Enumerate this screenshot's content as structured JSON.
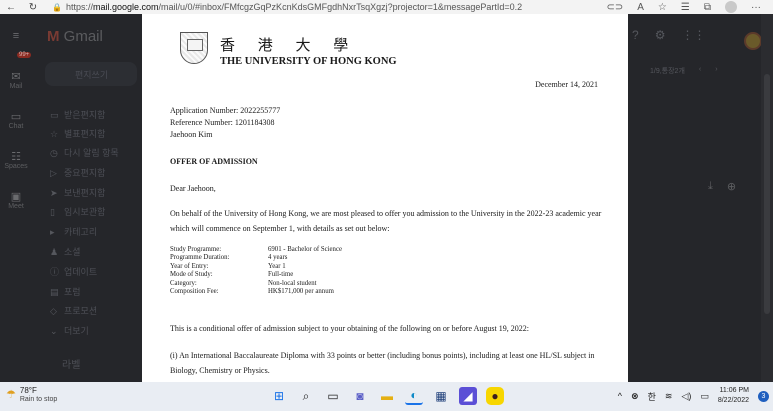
{
  "browser": {
    "url_prefix": "https://",
    "url_host": "mail.google.com",
    "url_path": "/mail/u/0/#inbox/FMfcgzGqPzKcnKdsGMFgdhNxrTsqXgzj?projector=1&messagePartId=0.2",
    "back_icon": "back-arrow-icon",
    "reload_icon": "reload-icon"
  },
  "gmail": {
    "logo_text": "Gmail",
    "rail": [
      {
        "label": "Mail",
        "icon": "mail-icon"
      },
      {
        "label": "Chat",
        "icon": "chat-icon"
      },
      {
        "label": "Spaces",
        "icon": "spaces-icon"
      },
      {
        "label": "Meet",
        "icon": "meet-icon"
      }
    ],
    "unread_badge": "99+",
    "compose_label": "편지쓰기",
    "folders": [
      "받은편지함",
      "별표편지함",
      "다시 알림 항목",
      "중요편지함",
      "보낸편지함",
      "임시보관함",
      "카테고리",
      "소셜",
      "업데이트",
      "포럼",
      "프로모션",
      "더보기"
    ],
    "labels_heading": "라벨",
    "pager_text": "1/9,통장2개"
  },
  "letter": {
    "university_cn": "香 港 大 學",
    "university_en": "THE UNIVERSITY OF HONG KONG",
    "date": "December 14, 2021",
    "application_number": "Application Number: 2022255777",
    "reference_number": "Reference Number: 1201184308",
    "name": "Jaehoon Kim",
    "heading": "OFFER OF ADMISSION",
    "salutation": "Dear Jaehoon,",
    "para1": "On behalf of the University of Hong Kong, we are most pleased to offer you admission to the University in the 2022-23 academic year which will commence on September 1, with details as set out below:",
    "details": [
      {
        "key": "Study Programme:",
        "value": "6901 - Bachelor of Science"
      },
      {
        "key": "Programme Duration:",
        "value": "4 years"
      },
      {
        "key": "Year of Entry:",
        "value": "Year 1"
      },
      {
        "key": "Mode of Study:",
        "value": "Full-time"
      },
      {
        "key": "Category:",
        "value": "Non-local student"
      },
      {
        "key": "Composition Fee:",
        "value": "HK$171,000 per annum"
      }
    ],
    "para2": "This is a conditional offer of admission subject to your obtaining of the following on or before August 19, 2022:",
    "para3": "(i) An International Baccalaureate Diploma with 33 points or better (including bonus points), including at least one HL/SL subject in Biology, Chemistry or Physics."
  },
  "taskbar": {
    "weather_temp": "78°F",
    "weather_desc": "Rain to stop",
    "time": "11:06 PM",
    "date": "8/22/2022",
    "notification_count": "3",
    "ime": "한"
  }
}
